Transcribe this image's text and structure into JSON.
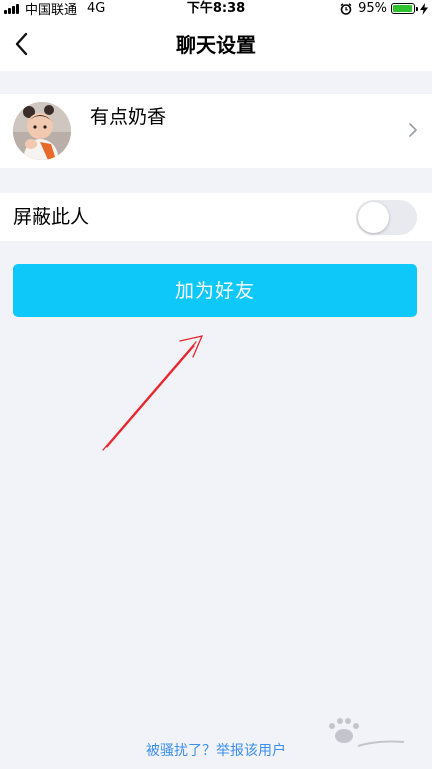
{
  "status_bar": {
    "carrier": "中国联通",
    "network": "4G",
    "time": "下午8:38",
    "battery_percent": "95%",
    "battery_level": 0.95
  },
  "nav": {
    "title": "聊天设置",
    "back_icon": "chevron-left-icon"
  },
  "profile": {
    "name": "有点奶香",
    "chevron_icon": "chevron-right-icon"
  },
  "block": {
    "label": "屏蔽此人",
    "enabled": false
  },
  "actions": {
    "add_friend_label": "加为好友"
  },
  "footer": {
    "report_label": "被骚扰了？举报该用户"
  },
  "colors": {
    "accent": "#0fc8fa",
    "link": "#3b8ff0",
    "background": "#f2f3f8",
    "annotation": "#e8252d",
    "battery": "#2fc22f"
  }
}
